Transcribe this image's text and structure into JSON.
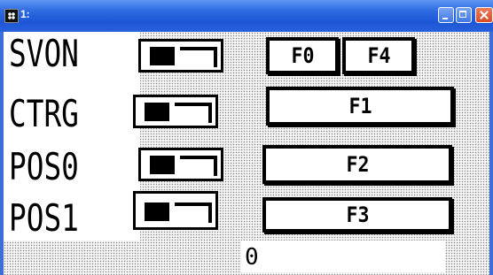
{
  "window": {
    "title": "1:",
    "icon": "app-grid-icon",
    "title_bar_color": "#2d6ae0"
  },
  "signals": [
    {
      "label": "SVON",
      "state": "off"
    },
    {
      "label": "CTRG",
      "state": "off"
    },
    {
      "label": "POS0",
      "state": "off"
    },
    {
      "label": "POS1",
      "state": "off"
    }
  ],
  "function_buttons": {
    "f0": "F0",
    "f4": "F4",
    "f1": "F1",
    "f2": "F2",
    "f3": "F3"
  },
  "value_readout": "0"
}
